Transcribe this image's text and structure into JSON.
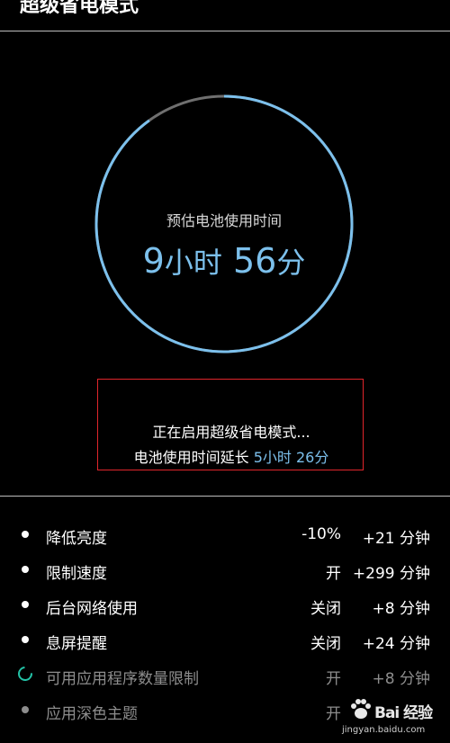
{
  "header": {
    "title": "超级省电模式"
  },
  "battery": {
    "estimate_label": "预估电池使用时间",
    "hours_value": "9",
    "hours_unit": "小时",
    "minutes_value": "56",
    "minutes_unit": "分",
    "ring_fill_fraction": 0.9,
    "ring_color": "#7cc0ec",
    "ring_track_color": "#6f6f6f"
  },
  "status": {
    "line1": "正在启用超级省电模式...",
    "line2_prefix": "电池使用时间延长 ",
    "line2_extension": "5小时 26分",
    "highlight_color": "#e0252b"
  },
  "settings": [
    {
      "label": "降低亮度",
      "state": "-10%",
      "gain": "+21 分钟",
      "status": "done"
    },
    {
      "label": "限制速度",
      "state": "开",
      "gain": "+299 分钟",
      "status": "done"
    },
    {
      "label": "后台网络使用",
      "state": "关闭",
      "gain": "+8 分钟",
      "status": "done"
    },
    {
      "label": "息屏提醒",
      "state": "关闭",
      "gain": "+24 分钟",
      "status": "done"
    },
    {
      "label": "可用应用程序数量限制",
      "state": "开",
      "gain": "+8 分钟",
      "status": "in-progress"
    },
    {
      "label": "应用深色主题",
      "state": "开",
      "gain": "",
      "status": "pending"
    }
  ],
  "watermark": {
    "brand_text": "Bai 经验",
    "url": "jingyan.baidu.com"
  }
}
